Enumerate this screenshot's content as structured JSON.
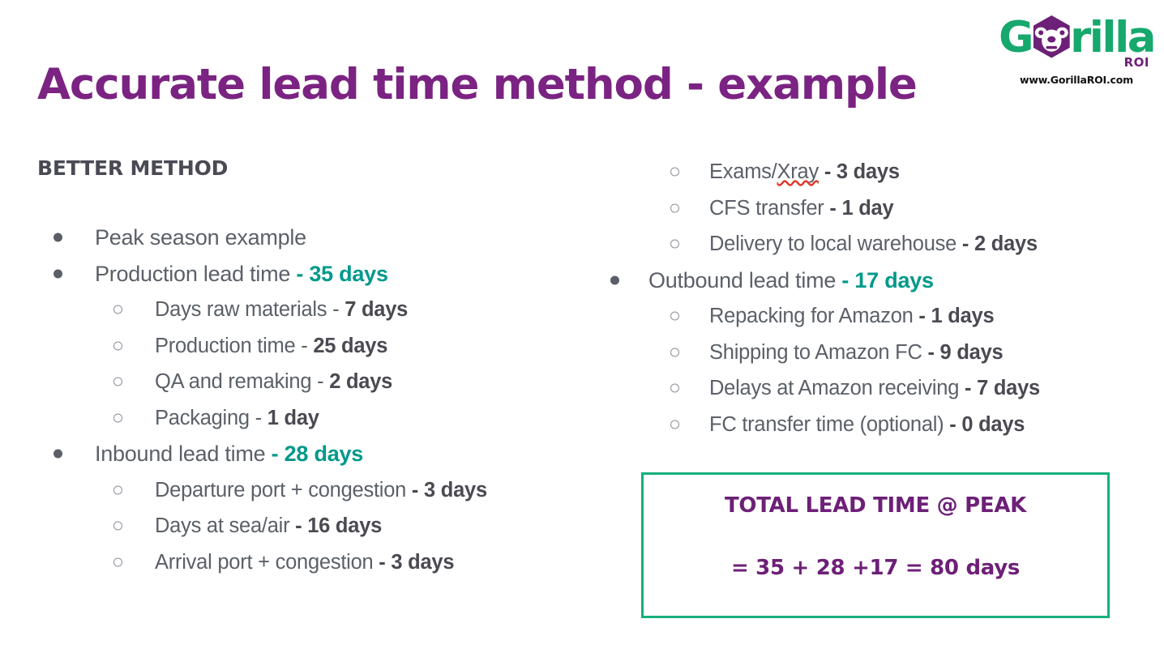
{
  "brand": {
    "logo_text_1": "G",
    "logo_text_2": "rilla",
    "logo_sub": "ROI",
    "logo_url": "www.GorillaROI.com",
    "green": "#16a86c",
    "purple": "#6d2077"
  },
  "header": {
    "title": "Accurate lead time method - example",
    "title_color": "#7b2382"
  },
  "left": {
    "section_heading": "BETTER METHOD",
    "items": [
      {
        "level": 1,
        "label": "Peak season example",
        "value": "",
        "value_style": "none"
      },
      {
        "level": 1,
        "label": "Production lead time ",
        "value": "- 35 days",
        "value_style": "teal"
      },
      {
        "level": 2,
        "label": "Days raw materials - ",
        "value": "7 days",
        "value_style": "gray"
      },
      {
        "level": 2,
        "label": "Production time - ",
        "value": "25 days",
        "value_style": "gray"
      },
      {
        "level": 2,
        "label": "QA and remaking - ",
        "value": "2 days",
        "value_style": "gray"
      },
      {
        "level": 2,
        "label": "Packaging - ",
        "value": "1 day",
        "value_style": "gray"
      },
      {
        "level": 1,
        "label": "Inbound lead time ",
        "value": "- 28 days",
        "value_style": "teal"
      },
      {
        "level": 2,
        "label": "Departure port + congestion ",
        "value": "- 3 days",
        "value_style": "gray"
      },
      {
        "level": 2,
        "label": "Days at sea/air ",
        "value": "- 16 days",
        "value_style": "gray"
      },
      {
        "level": 2,
        "label": "Arrival port + congestion ",
        "value": "- 3 days",
        "value_style": "gray"
      }
    ]
  },
  "right": {
    "items": [
      {
        "level": 2,
        "label": "Exams/Xray ",
        "value": "- 3 days",
        "value_style": "gray",
        "misspelled": "Xray"
      },
      {
        "level": 2,
        "label": "CFS transfer ",
        "value": "- 1 day",
        "value_style": "gray"
      },
      {
        "level": 2,
        "label": "Delivery to local warehouse ",
        "value": "- 2 days",
        "value_style": "gray"
      },
      {
        "level": 1,
        "label": "Outbound lead time ",
        "value": "- 17 days",
        "value_style": "teal"
      },
      {
        "level": 2,
        "label": "Repacking for Amazon ",
        "value": "- 1 days",
        "value_style": "gray"
      },
      {
        "level": 2,
        "label": "Shipping to Amazon FC ",
        "value": "- 9 days",
        "value_style": "gray"
      },
      {
        "level": 2,
        "label": "Delays at Amazon receiving ",
        "value": "- 7 days",
        "value_style": "gray"
      },
      {
        "level": 2,
        "label": "FC transfer time (optional) ",
        "value": "- 0 days",
        "value_style": "gray"
      }
    ],
    "total_box": {
      "title": "TOTAL LEAD TIME @ PEAK",
      "equation": "= 35 + 28 +17 = 80 days",
      "border_color": "#15b07a",
      "text_color": "#6d2077"
    }
  }
}
